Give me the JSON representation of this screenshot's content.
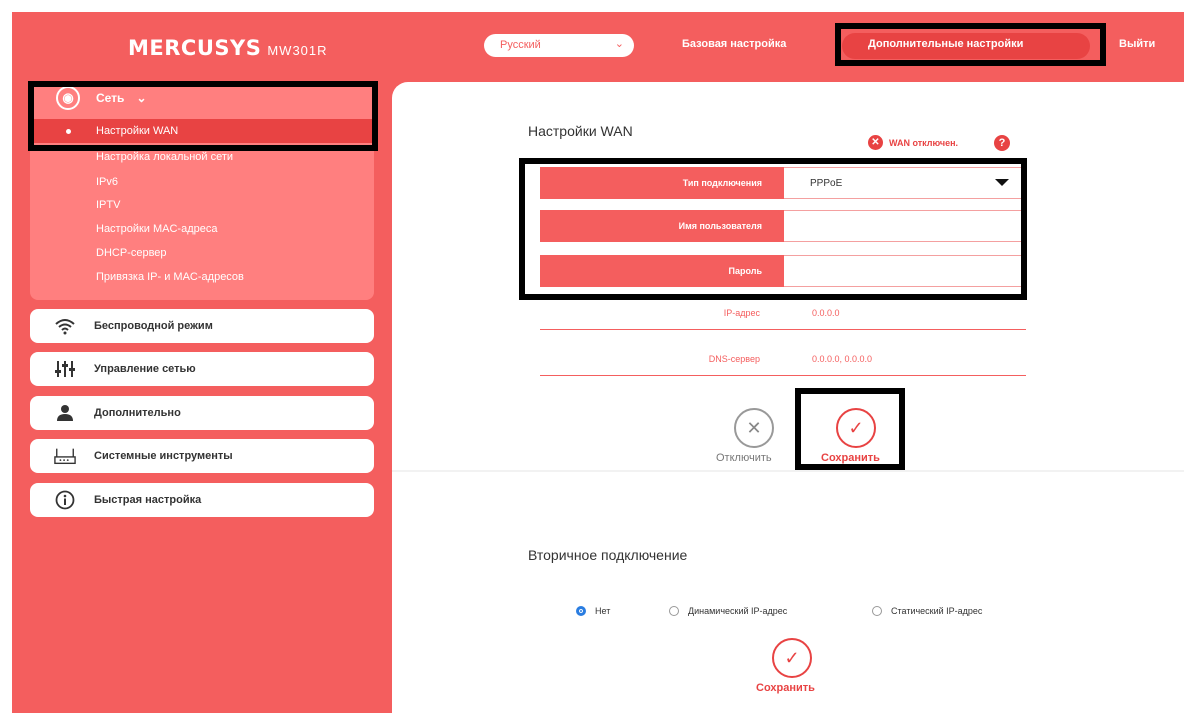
{
  "header": {
    "brand": "MERCUSYS",
    "model": "MW301R",
    "language": "Русский",
    "nav_basic": "Базовая настройка",
    "nav_advanced": "Дополнительные настройки",
    "nav_exit": "Выйти"
  },
  "sidebar": {
    "network": {
      "label": "Сеть",
      "icon": "globe-icon",
      "items": [
        {
          "label": "Настройки WAN",
          "active": true
        },
        {
          "label": "Настройка локальной сети"
        },
        {
          "label": "IPv6"
        },
        {
          "label": "IPTV"
        },
        {
          "label": "Настройки MAC-адреса"
        },
        {
          "label": "DHCP-сервер"
        },
        {
          "label": "Привязка IP- и MAC-адресов"
        }
      ]
    },
    "menu": [
      {
        "label": "Беспроводной режим",
        "icon": "wifi-icon"
      },
      {
        "label": "Управление сетью",
        "icon": "sliders-icon"
      },
      {
        "label": "Дополнительно",
        "icon": "user-icon"
      },
      {
        "label": "Системные инструменты",
        "icon": "router-icon"
      },
      {
        "label": "Быстрая настройка",
        "icon": "info-icon"
      }
    ]
  },
  "wan": {
    "title": "Настройки WAN",
    "status": "WAN отключен.",
    "help": "?",
    "connection_type_label": "Тип подключения",
    "connection_type_value": "PPPoE",
    "username_label": "Имя пользователя",
    "username_value": "",
    "password_label": "Пароль",
    "password_value": "",
    "ip_label": "IP-адрес",
    "ip_value": "0.0.0.0",
    "dns_label": "DNS-сервер",
    "dns_value": "0.0.0.0, 0.0.0.0",
    "disconnect_label": "Отключить",
    "save_label": "Сохранить"
  },
  "secondary": {
    "title": "Вторичное подключение",
    "options": [
      {
        "label": "Нет",
        "selected": true
      },
      {
        "label": "Динамический IP-адрес",
        "selected": false
      },
      {
        "label": "Статический IP-адрес",
        "selected": false
      }
    ],
    "save_label": "Сохранить"
  },
  "colors": {
    "accent": "#f45e5e",
    "accent_dark": "#e84343",
    "radio_selected": "#2a7de1",
    "highlight_box": "#000000"
  }
}
